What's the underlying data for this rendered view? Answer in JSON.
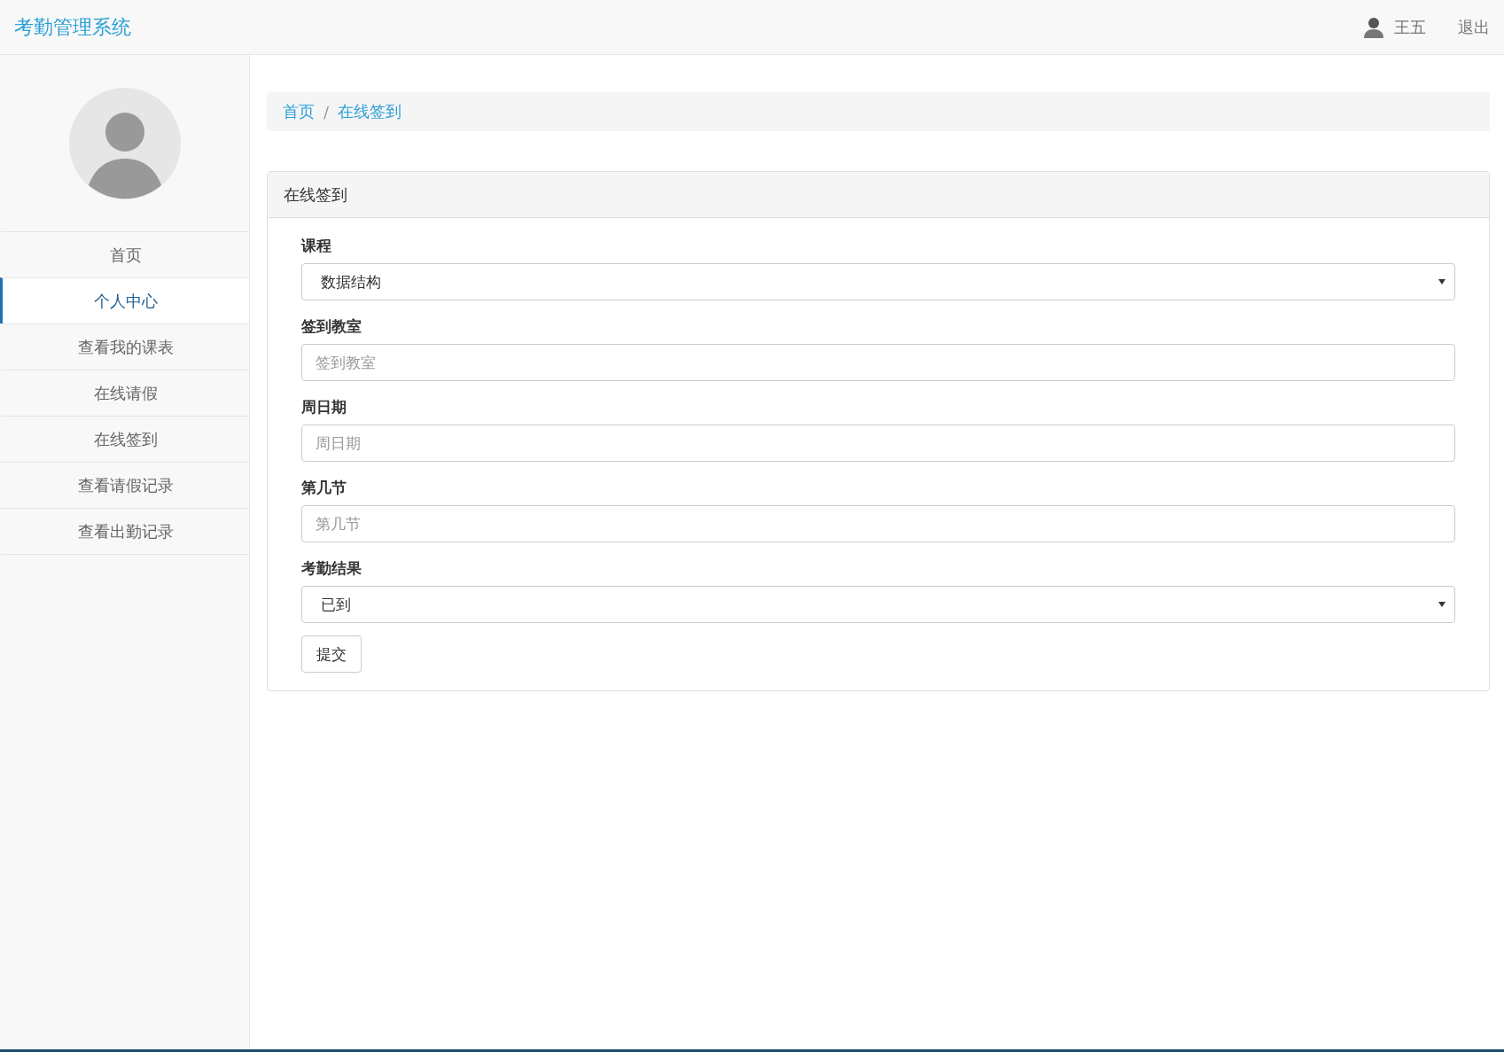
{
  "header": {
    "brand": "考勤管理系统",
    "user": "王五",
    "logout": "退出"
  },
  "sidebar": {
    "items": [
      {
        "label": "首页",
        "selected": false
      },
      {
        "label": "个人中心",
        "selected": true
      },
      {
        "label": "查看我的课表",
        "selected": false
      },
      {
        "label": "在线请假",
        "selected": false
      },
      {
        "label": "在线签到",
        "selected": false
      },
      {
        "label": "查看请假记录",
        "selected": false
      },
      {
        "label": "查看出勤记录",
        "selected": false
      }
    ]
  },
  "breadcrumb": [
    {
      "label": "首页"
    },
    {
      "label": "在线签到"
    }
  ],
  "breadcrumb_separator": "/",
  "panel": {
    "title": "在线签到",
    "fields": [
      {
        "kind": "select",
        "label": "课程",
        "value": "数据结构"
      },
      {
        "kind": "text",
        "label": "签到教室",
        "placeholder": "签到教室"
      },
      {
        "kind": "text",
        "label": "周日期",
        "placeholder": "周日期"
      },
      {
        "kind": "text",
        "label": "第几节",
        "placeholder": "第几节"
      },
      {
        "kind": "select",
        "label": "考勤结果",
        "value": "已到"
      }
    ],
    "submit": "提交"
  }
}
